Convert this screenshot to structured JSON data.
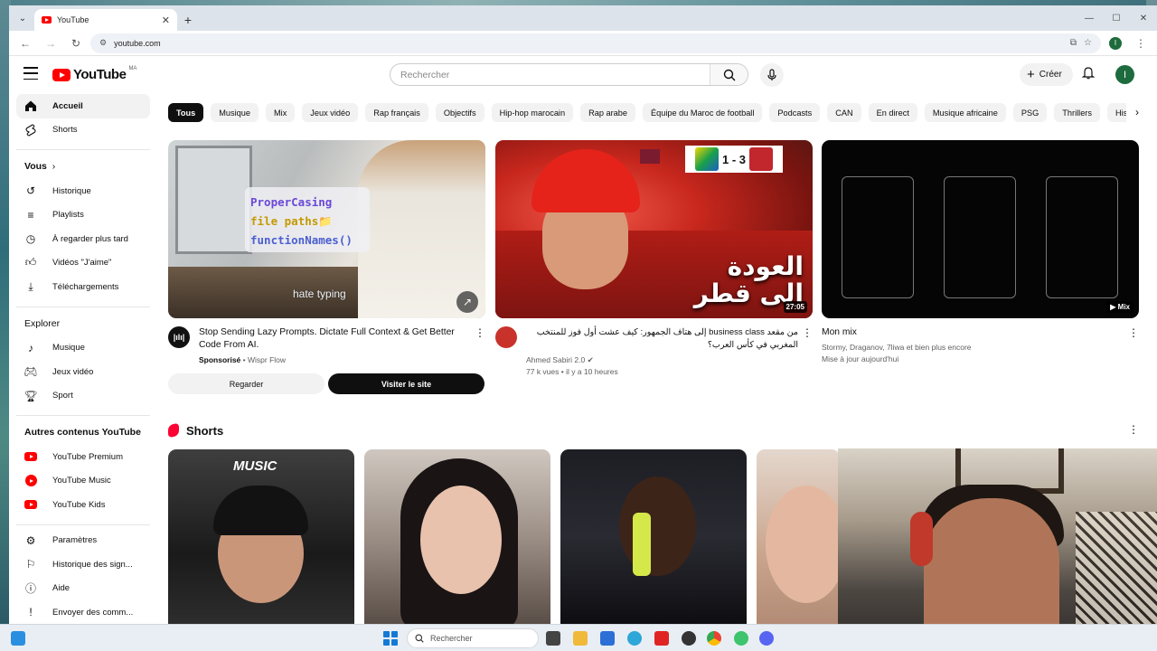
{
  "browser": {
    "tab_title": "YouTube",
    "tab_close": "✕",
    "new_tab": "+",
    "url": "youtube.com",
    "profile_initial": "I"
  },
  "masthead": {
    "logo_text": "YouTube",
    "region": "MA",
    "search_placeholder": "Rechercher",
    "create_label": "Créer",
    "avatar_initial": "I"
  },
  "sidebar": {
    "main": [
      {
        "label": "Accueil",
        "icon": "home-icon"
      },
      {
        "label": "Shorts",
        "icon": "shorts-icon"
      }
    ],
    "you_header": "Vous",
    "you": [
      {
        "label": "Historique",
        "icon": "history-icon"
      },
      {
        "label": "Playlists",
        "icon": "playlists-icon"
      },
      {
        "label": "À regarder plus tard",
        "icon": "watch-later-icon"
      },
      {
        "label": "Vidéos \"J'aime\"",
        "icon": "thumb-up-icon"
      },
      {
        "label": "Téléchargements",
        "icon": "download-icon"
      }
    ],
    "explore_header": "Explorer",
    "explore": [
      {
        "label": "Musique",
        "icon": "music-icon"
      },
      {
        "label": "Jeux vidéo",
        "icon": "gaming-icon"
      },
      {
        "label": "Sport",
        "icon": "trophy-icon"
      }
    ],
    "more_header": "Autres contenus YouTube",
    "more": [
      {
        "label": "YouTube Premium",
        "icon": "youtube-premium-icon"
      },
      {
        "label": "YouTube Music",
        "icon": "youtube-music-icon"
      },
      {
        "label": "YouTube Kids",
        "icon": "youtube-kids-icon"
      }
    ],
    "settings": [
      {
        "label": "Paramètres",
        "icon": "gear-icon"
      },
      {
        "label": "Historique des sign...",
        "icon": "flag-icon"
      },
      {
        "label": "Aide",
        "icon": "help-icon"
      },
      {
        "label": "Envoyer des comm...",
        "icon": "feedback-icon"
      }
    ]
  },
  "chips": [
    "Tous",
    "Musique",
    "Mix",
    "Jeux vidéo",
    "Rap français",
    "Objectifs",
    "Hip-hop marocain",
    "Rap arabe",
    "Équipe du Maroc de football",
    "Podcasts",
    "CAN",
    "En direct",
    "Musique africaine",
    "PSG",
    "Thrillers",
    "Histoire"
  ],
  "videos": [
    {
      "title": "Stop Sending Lazy Prompts. Dictate Full Context & Get Better Code From AI.",
      "sponsored": "Sponsorisé",
      "channel": "Wispr Flow",
      "code_lines": [
        "ProperCasing",
        "file paths📁",
        "functionNames()"
      ],
      "overlay_text": "hate typing",
      "btn_watch": "Regarder",
      "btn_visit": "Visiter le site"
    },
    {
      "title": "من مقعد business class إلى هتاف الجمهور: كيف عشت أول فوز للمنتخب المغربي في كأس العرب؟",
      "channel": "Ahmed Sabiri 2.0",
      "stats": "77 k vues • il y a 10 heures",
      "duration": "27:05",
      "score": "1 - 3",
      "thumb_title_1": "العودة",
      "thumb_title_2": "الى قطر"
    },
    {
      "title": "Mon mix",
      "subtitle": "Stormy, Draganov, 7liwa et bien plus encore",
      "updated": "Mise à jour aujourd'hui",
      "badge": "Mix"
    }
  ],
  "shorts": {
    "title": "Shorts",
    "overlay_music": "MUSIC"
  },
  "taskbar": {
    "search_placeholder": "Rechercher"
  }
}
